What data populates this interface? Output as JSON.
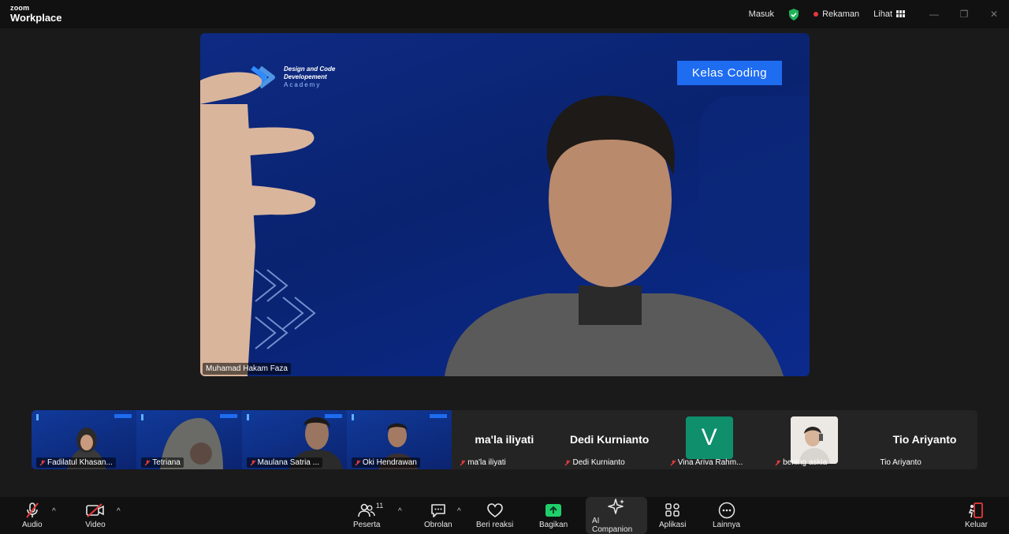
{
  "app": {
    "brand_small": "zoom",
    "brand_big": "Workplace"
  },
  "titlebar": {
    "masuk": "Masuk",
    "rekaman": "Rekaman",
    "lihat": "Lihat"
  },
  "main_video": {
    "logo_line1": "Design and Code",
    "logo_line2": "Developement",
    "logo_line3": "Academy",
    "badge": "Kelas Coding",
    "speaker_name": "Muhamad Hakam Faza"
  },
  "gallery": [
    {
      "name": "Fadilatul Khasan...",
      "type": "video",
      "muted": true
    },
    {
      "name": "Tetriana",
      "type": "video",
      "muted": true
    },
    {
      "name": "Maulana Satria ...",
      "type": "video",
      "muted": true
    },
    {
      "name": "Oki Hendrawan",
      "type": "video",
      "muted": true
    },
    {
      "name": "ma'la iliyati",
      "big": "ma'la iliyati",
      "type": "name",
      "muted": true
    },
    {
      "name": "Dedi Kurnianto",
      "big": "Dedi Kurnianto",
      "type": "name",
      "muted": true
    },
    {
      "name": "Vina Ariva Rahm...",
      "avatar": "V",
      "type": "avatar",
      "muted": true
    },
    {
      "name": "bening askia",
      "type": "photo",
      "muted": true
    },
    {
      "name": "Tio Ariyanto",
      "big": "Tio Ariyanto",
      "type": "name",
      "muted": false
    }
  ],
  "toolbar": {
    "audio": "Audio",
    "video": "Video",
    "peserta": "Peserta",
    "peserta_count": "11",
    "obrolan": "Obrolan",
    "reaksi": "Beri reaksi",
    "bagikan": "Bagikan",
    "ai": "AI Companion",
    "aplikasi": "Aplikasi",
    "lainnya": "Lainnya",
    "keluar": "Keluar"
  },
  "colors": {
    "accent_blue": "#1e6cf0",
    "share_green": "#1fcf6b",
    "leave_red": "#e8393b",
    "avatar_green": "#0f8f6c"
  }
}
